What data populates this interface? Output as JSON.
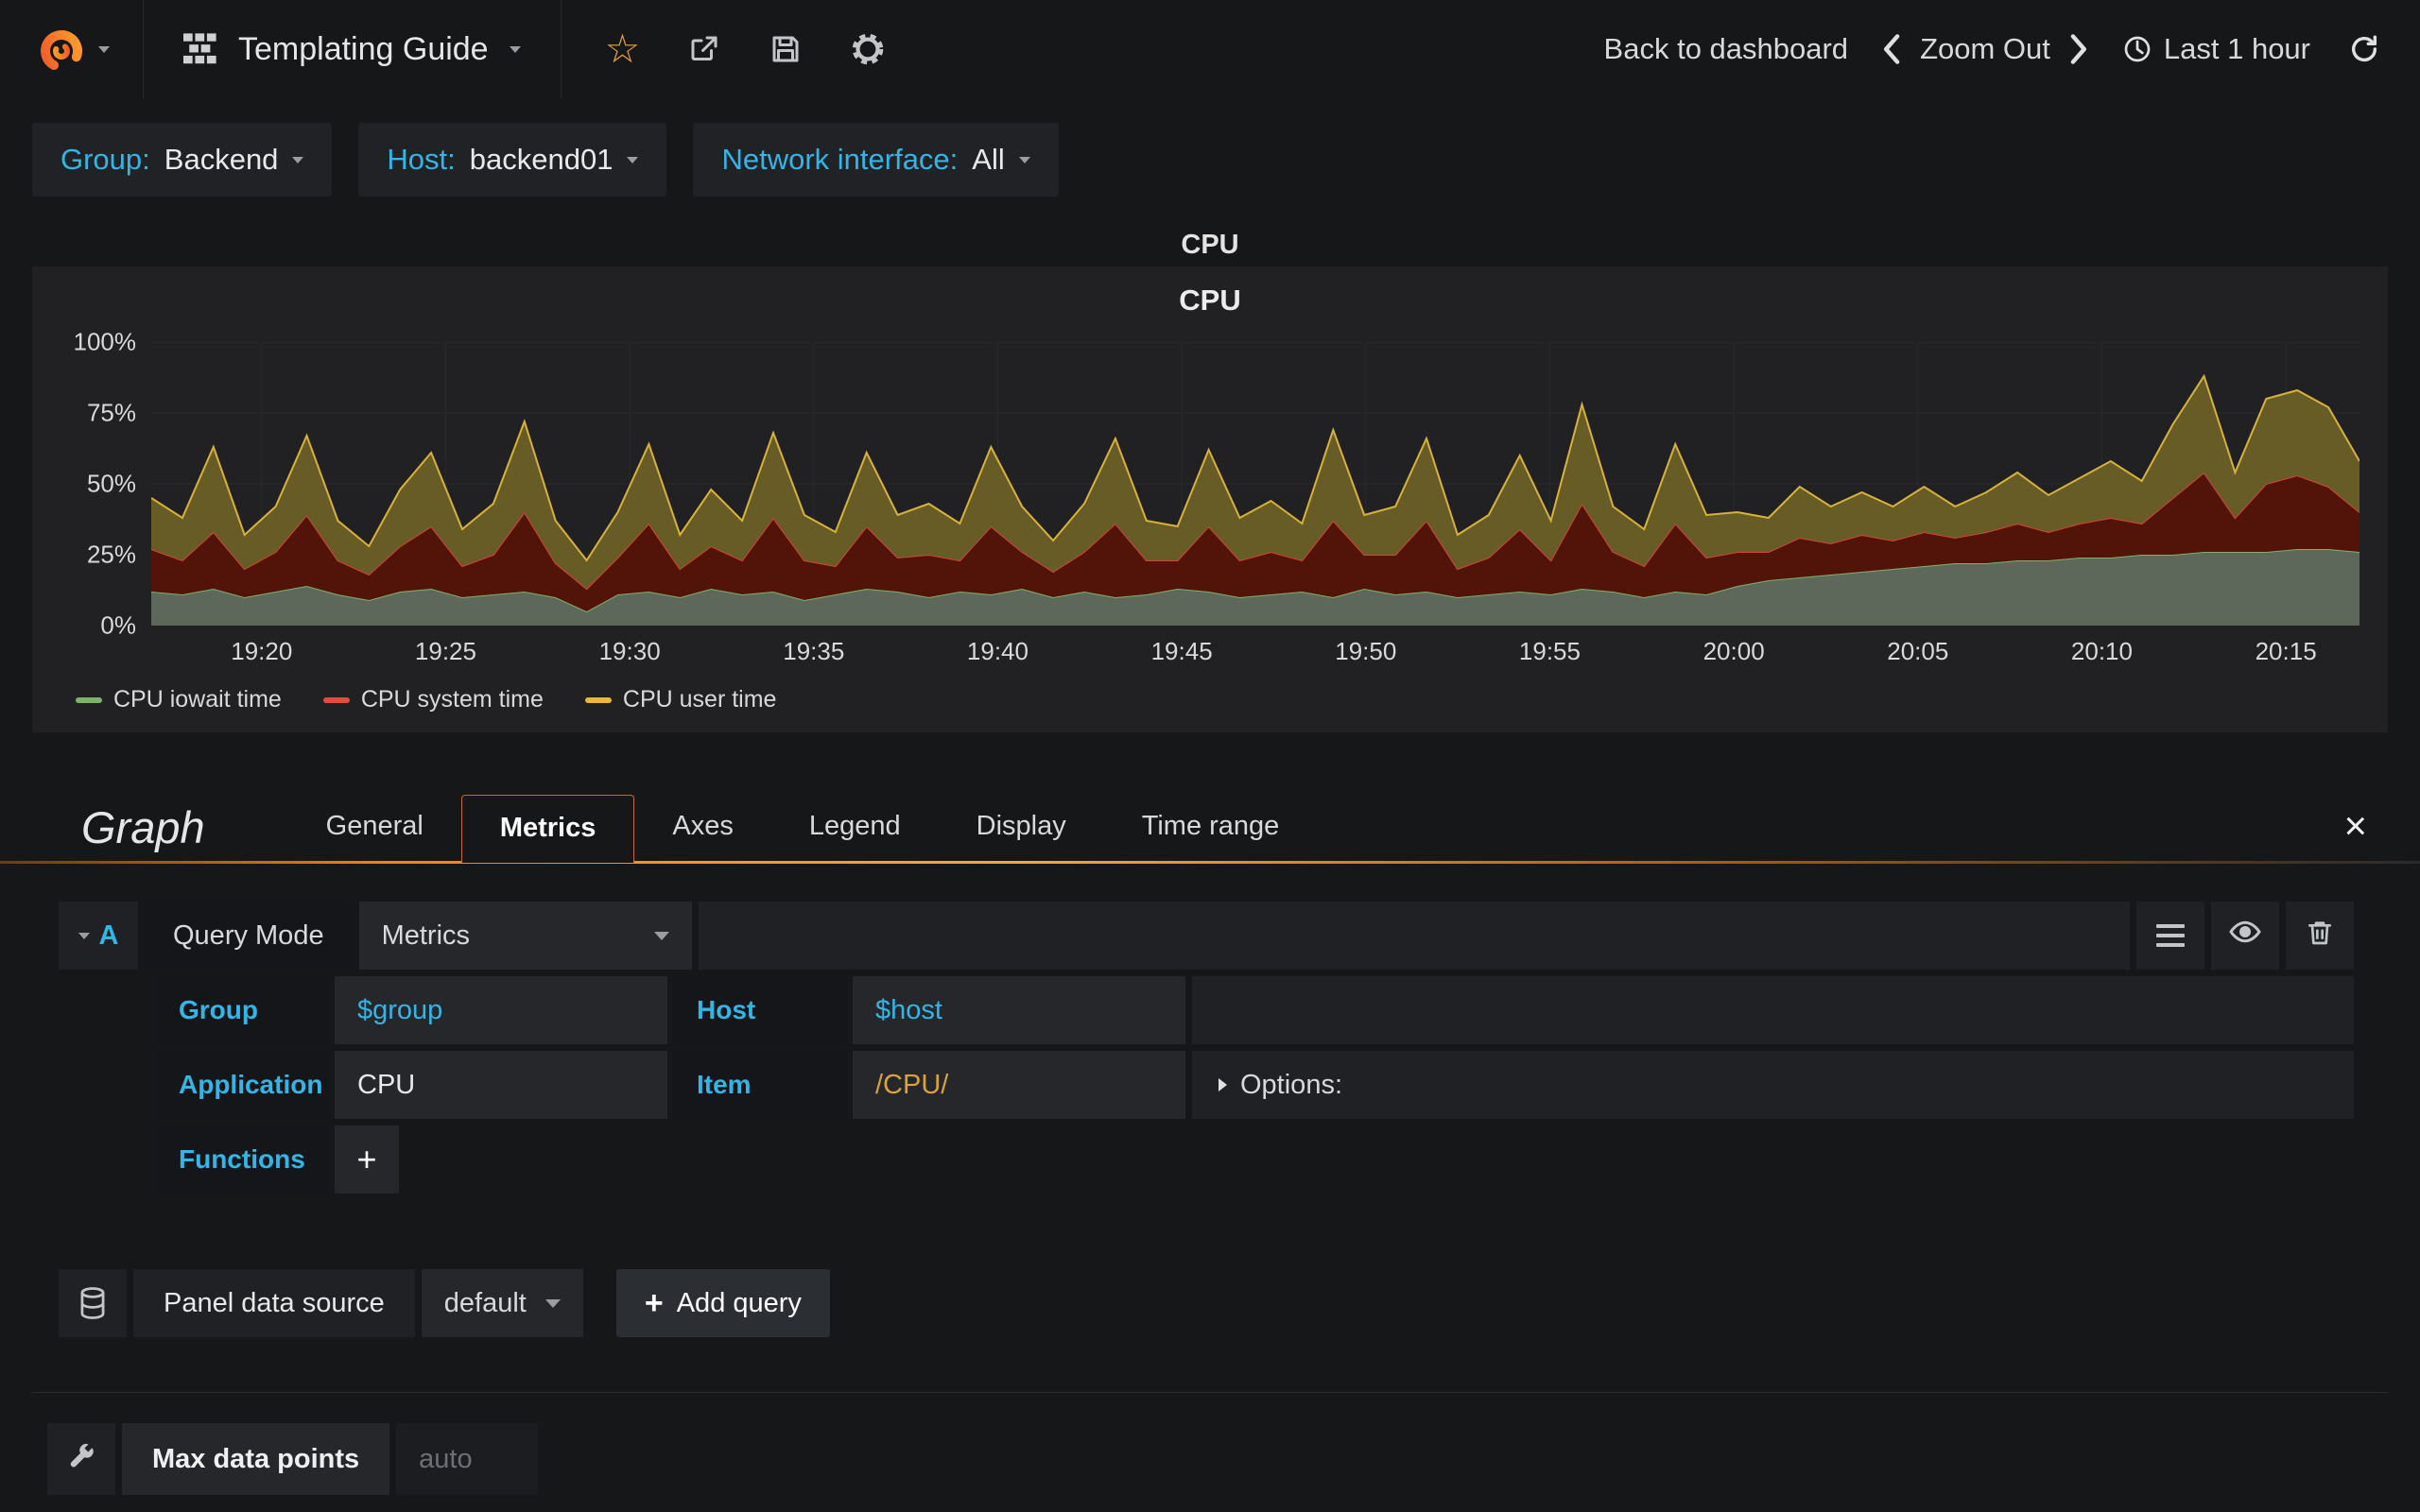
{
  "nav": {
    "title": "Templating Guide",
    "back_to_dashboard": "Back to dashboard",
    "zoom_out": "Zoom Out",
    "time_range": "Last 1 hour",
    "icons": [
      "grafana-logo-icon",
      "grid-icon",
      "star-icon",
      "share-icon",
      "save-icon",
      "gear-icon",
      "chevron-left-icon",
      "chevron-right-icon",
      "clock-icon",
      "refresh-icon"
    ]
  },
  "variables": [
    {
      "label": "Group:",
      "value": "Backend"
    },
    {
      "label": "Host:",
      "value": "backend01"
    },
    {
      "label": "Network interface:",
      "value": "All"
    }
  ],
  "panel": {
    "header_title": "CPU",
    "chart_title": "CPU"
  },
  "chart_data": {
    "type": "area",
    "stacked": true,
    "title": "CPU",
    "ylim": [
      0,
      100
    ],
    "grid": true,
    "legend_position": "bottom-left",
    "time_start": "19:17",
    "time_end": "20:17",
    "x_ticks": [
      "19:20",
      "19:25",
      "19:30",
      "19:35",
      "19:40",
      "19:45",
      "19:50",
      "19:55",
      "20:00",
      "20:05",
      "20:10",
      "20:15"
    ],
    "y_ticks": [
      "100%",
      "75%",
      "50%",
      "25%",
      "0%"
    ],
    "series": [
      {
        "name": "CPU iowait time",
        "color": "#7eb26d",
        "fill": "#5d685a",
        "values": [
          12,
          11,
          13,
          10,
          12,
          14,
          11,
          9,
          12,
          13,
          10,
          11,
          12,
          10,
          5,
          11,
          12,
          10,
          13,
          11,
          12,
          9,
          11,
          13,
          12,
          10,
          12,
          11,
          13,
          10,
          12,
          10,
          11,
          13,
          12,
          10,
          11,
          12,
          10,
          13,
          11,
          12,
          10,
          11,
          12,
          11,
          13,
          12,
          10,
          12,
          11,
          14,
          16,
          17,
          18,
          19,
          20,
          21,
          22,
          22,
          23,
          23,
          24,
          24,
          25,
          25,
          26,
          26,
          26,
          27,
          27,
          26
        ]
      },
      {
        "name": "CPU system time",
        "color": "#d4443a",
        "fill": "#521409",
        "values": [
          15,
          12,
          20,
          10,
          14,
          25,
          12,
          9,
          16,
          22,
          11,
          14,
          28,
          12,
          8,
          13,
          24,
          10,
          15,
          12,
          26,
          14,
          10,
          22,
          12,
          15,
          11,
          24,
          13,
          9,
          14,
          26,
          12,
          10,
          23,
          13,
          15,
          11,
          27,
          12,
          14,
          25,
          10,
          13,
          22,
          12,
          30,
          14,
          11,
          24,
          13,
          12,
          10,
          14,
          11,
          13,
          10,
          12,
          9,
          11,
          13,
          10,
          12,
          14,
          11,
          20,
          28,
          12,
          24,
          26,
          22,
          14
        ]
      },
      {
        "name": "CPU user time",
        "color": "#d8b23a",
        "fill": "#675c26",
        "values": [
          18,
          15,
          30,
          12,
          16,
          28,
          14,
          10,
          20,
          26,
          13,
          18,
          32,
          15,
          10,
          16,
          28,
          12,
          20,
          14,
          30,
          16,
          12,
          26,
          15,
          18,
          13,
          28,
          16,
          11,
          17,
          30,
          14,
          12,
          27,
          15,
          18,
          13,
          32,
          14,
          17,
          29,
          12,
          15,
          26,
          14,
          35,
          16,
          13,
          28,
          15,
          14,
          12,
          18,
          13,
          15,
          12,
          16,
          11,
          14,
          18,
          13,
          16,
          20,
          15,
          26,
          34,
          16,
          30,
          30,
          28,
          18
        ]
      }
    ],
    "legend": [
      {
        "label": "CPU iowait time",
        "color": "#7eb26d"
      },
      {
        "label": "CPU system time",
        "color": "#e24d42"
      },
      {
        "label": "CPU user time",
        "color": "#eab839"
      }
    ]
  },
  "editor": {
    "panel_type": "Graph",
    "tabs": [
      "General",
      "Metrics",
      "Axes",
      "Legend",
      "Display",
      "Time range"
    ],
    "active_tab": "Metrics",
    "close_label": "×",
    "query": {
      "ref_letter": "A",
      "mode_label": "Query Mode",
      "mode_value": "Metrics",
      "group": {
        "label": "Group",
        "value": "$group"
      },
      "host": {
        "label": "Host",
        "value": "$host"
      },
      "application": {
        "label": "Application",
        "value": "CPU"
      },
      "item": {
        "label": "Item",
        "value": "/CPU/"
      },
      "options_label": "Options:",
      "functions_label": "Functions",
      "add_function_label": "+"
    },
    "datasource": {
      "label": "Panel data source",
      "value": "default",
      "add_query_plus": "+",
      "add_query_label": "Add query"
    },
    "max_data_points": {
      "label": "Max data points",
      "placeholder": "auto"
    }
  },
  "colors": {
    "accent_cyan": "#33b5e5",
    "accent_orange": "#ef8220",
    "panel_bg": "#212124",
    "page_bg": "#161719"
  }
}
